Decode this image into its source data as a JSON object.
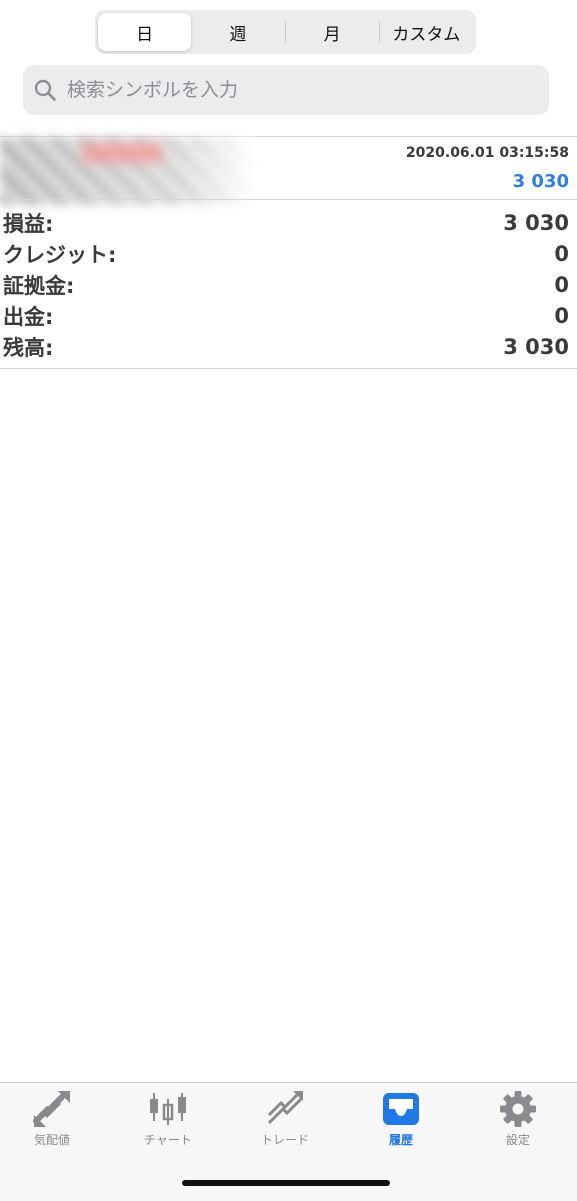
{
  "period_tabs": [
    {
      "label": "日",
      "active": true
    },
    {
      "label": "週",
      "active": false
    },
    {
      "label": "月",
      "active": false
    },
    {
      "label": "カスタム",
      "active": false
    }
  ],
  "search": {
    "placeholder": "検索シンボルを入力"
  },
  "deal": {
    "timestamp": "2020.06.01 03:15:58",
    "profit": "3 030",
    "profit_color": "#2f7ee6"
  },
  "summary": [
    {
      "label": "損益:",
      "value": "3 030"
    },
    {
      "label": "クレジット:",
      "value": "0"
    },
    {
      "label": "証拠金:",
      "value": "0"
    },
    {
      "label": "出金:",
      "value": "0"
    },
    {
      "label": "残高:",
      "value": "3 030"
    }
  ],
  "tabbar": [
    {
      "label": "気配値",
      "icon": "quotes-arrows-icon",
      "active": false
    },
    {
      "label": "チャート",
      "icon": "candlestick-chart-icon",
      "active": false
    },
    {
      "label": "トレード",
      "icon": "trade-trend-icon",
      "active": false
    },
    {
      "label": "履歴",
      "icon": "history-inbox-icon",
      "active": true
    },
    {
      "label": "設定",
      "icon": "settings-gear-icon",
      "active": false
    }
  ],
  "colors": {
    "accent": "#1f78e6",
    "icon_inactive": "#8a8a8e"
  }
}
